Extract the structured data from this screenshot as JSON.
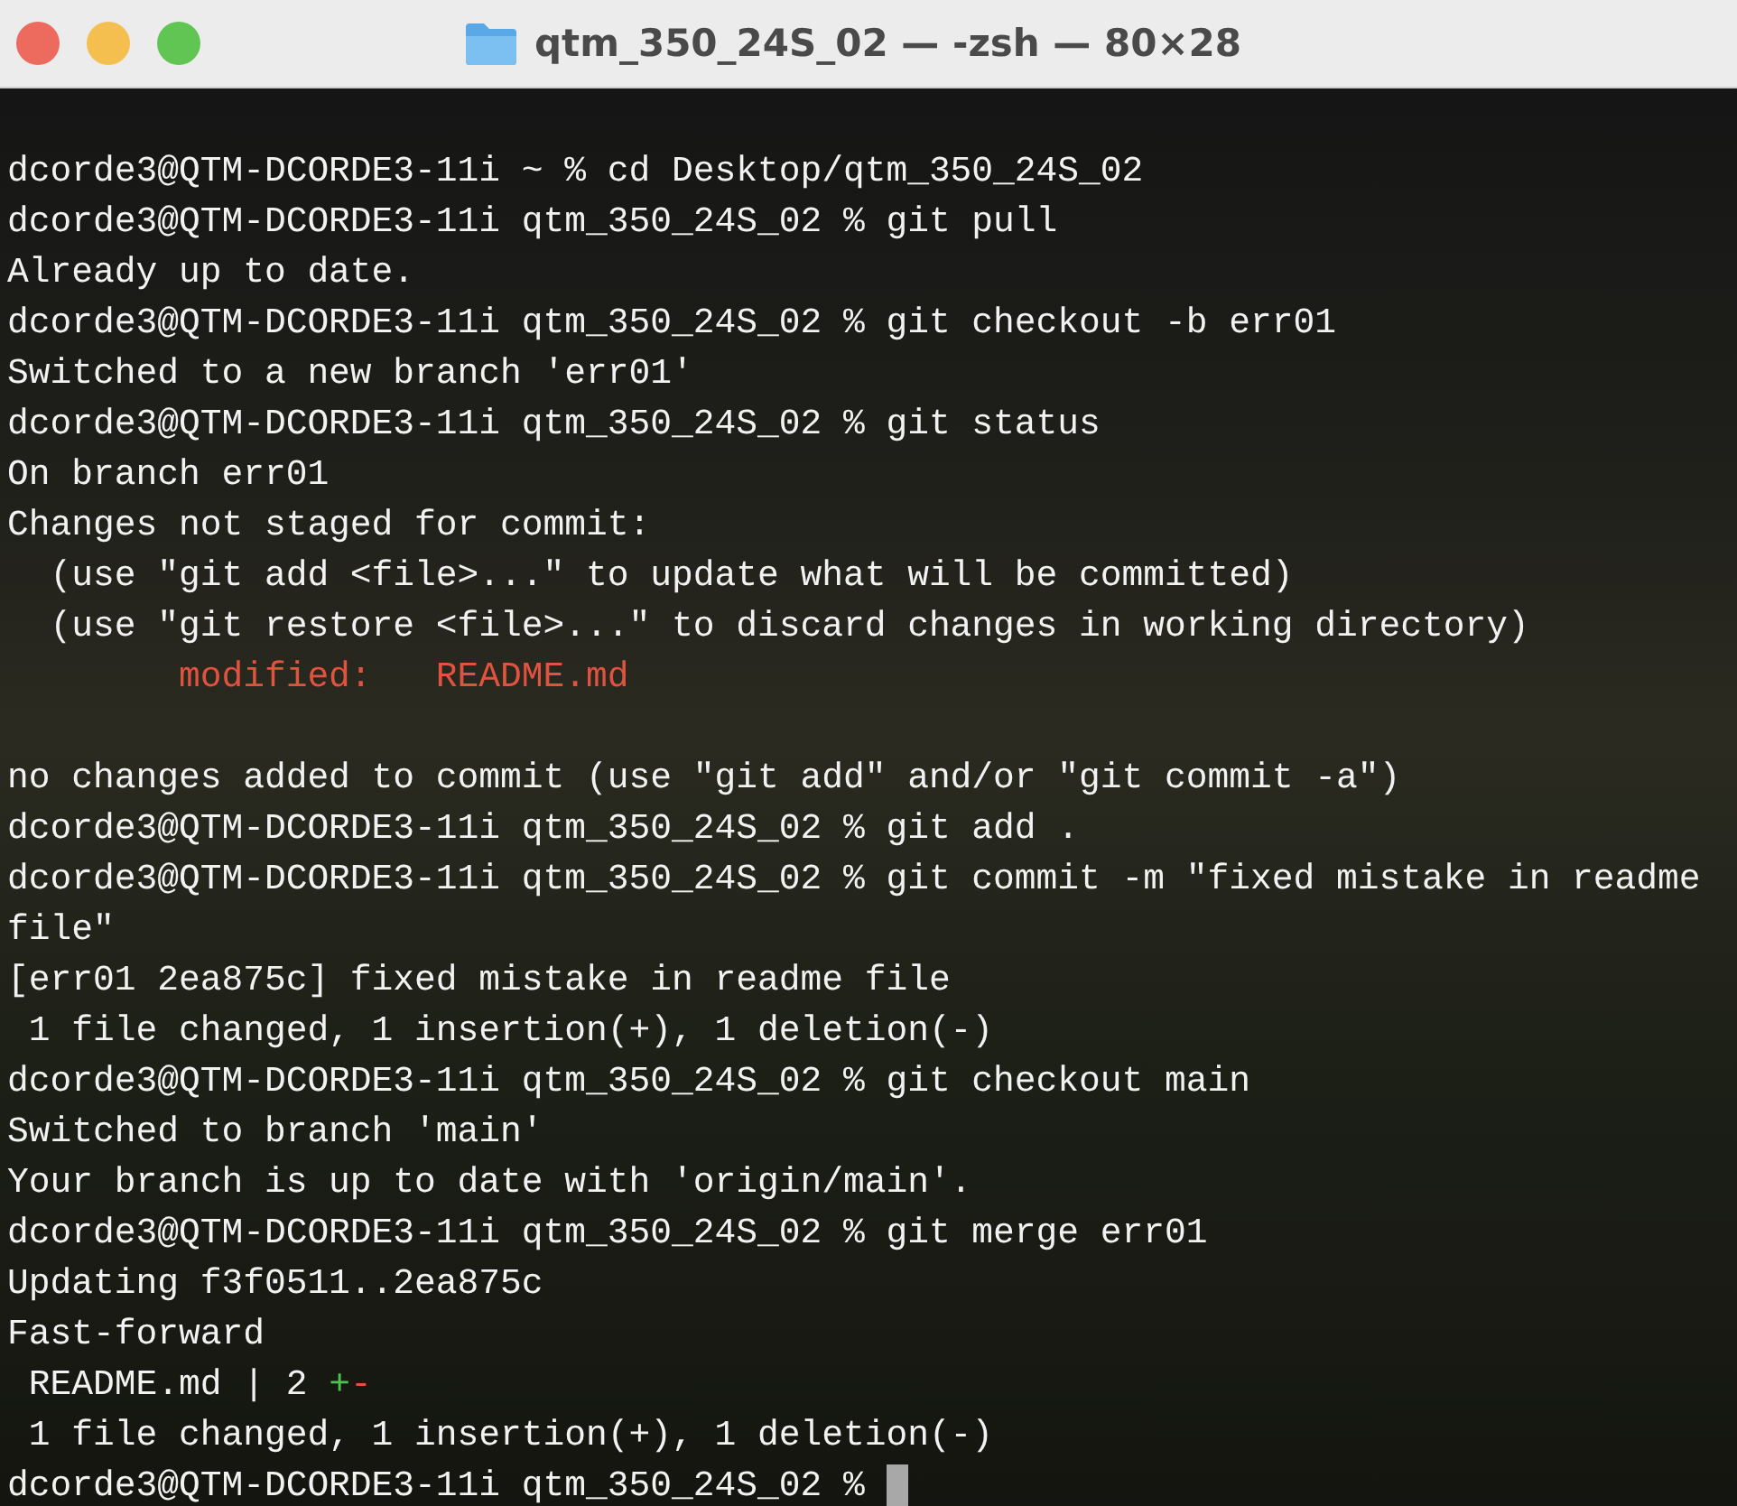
{
  "window": {
    "title": "qtm_350_24S_02 — -zsh — 80×28"
  },
  "terminal": {
    "blocks": [
      {
        "lines": [
          {
            "segments": [
              {
                "text": "dcorde3@QTM-DCORDE3-11i ~ % cd Desktop/qtm_350_24S_02",
                "kind": "plain"
              }
            ]
          },
          {
            "segments": [
              {
                "text": "dcorde3@QTM-DCORDE3-11i qtm_350_24S_02 % git pull",
                "kind": "plain"
              }
            ]
          },
          {
            "segments": [
              {
                "text": "Already up to date.",
                "kind": "plain"
              }
            ]
          },
          {
            "segments": [
              {
                "text": "dcorde3@QTM-DCORDE3-11i qtm_350_24S_02 % git checkout -b err01",
                "kind": "plain"
              }
            ]
          },
          {
            "segments": [
              {
                "text": "Switched to a new branch 'err01'",
                "kind": "plain"
              }
            ]
          },
          {
            "segments": [
              {
                "text": "dcorde3@QTM-DCORDE3-11i qtm_350_24S_02 % git status",
                "kind": "plain"
              }
            ]
          },
          {
            "segments": [
              {
                "text": "On branch err01",
                "kind": "plain"
              }
            ]
          },
          {
            "segments": [
              {
                "text": "Changes not staged for commit:",
                "kind": "plain"
              }
            ]
          },
          {
            "segments": [
              {
                "text": "  (use \"git add <file>...\" to update what will be committed)",
                "kind": "plain"
              }
            ]
          },
          {
            "segments": [
              {
                "text": "  (use \"git restore <file>...\" to discard changes in working directory)",
                "kind": "plain"
              }
            ]
          },
          {
            "segments": [
              {
                "text": "        modified:   README.md",
                "kind": "removed"
              }
            ]
          }
        ]
      },
      {
        "lines": [
          {
            "segments": [
              {
                "text": "no changes added to commit (use \"git add\" and/or \"git commit -a\")",
                "kind": "plain"
              }
            ]
          },
          {
            "segments": [
              {
                "text": "dcorde3@QTM-DCORDE3-11i qtm_350_24S_02 % git add .",
                "kind": "plain"
              }
            ]
          },
          {
            "segments": [
              {
                "text": "dcorde3@QTM-DCORDE3-11i qtm_350_24S_02 % git commit -m \"fixed mistake in readme",
                "kind": "plain"
              }
            ]
          },
          {
            "segments": [
              {
                "text": "file\"",
                "kind": "plain"
              }
            ]
          },
          {
            "segments": [
              {
                "text": "[err01 2ea875c] fixed mistake in readme file",
                "kind": "plain"
              }
            ]
          },
          {
            "segments": [
              {
                "text": " 1 file changed, 1 insertion(+), 1 deletion(-)",
                "kind": "plain"
              }
            ]
          },
          {
            "segments": [
              {
                "text": "dcorde3@QTM-DCORDE3-11i qtm_350_24S_02 % git checkout main",
                "kind": "plain"
              }
            ]
          },
          {
            "segments": [
              {
                "text": "Switched to branch 'main'",
                "kind": "plain"
              }
            ]
          },
          {
            "segments": [
              {
                "text": "Your branch is up to date with 'origin/main'.",
                "kind": "plain"
              }
            ]
          },
          {
            "segments": [
              {
                "text": "dcorde3@QTM-DCORDE3-11i qtm_350_24S_02 % git merge err01",
                "kind": "plain"
              }
            ]
          },
          {
            "segments": [
              {
                "text": "Updating f3f0511..2ea875c",
                "kind": "plain"
              }
            ]
          },
          {
            "segments": [
              {
                "text": "Fast-forward",
                "kind": "plain"
              }
            ]
          },
          {
            "segments": [
              {
                "text": " README.md | 2 ",
                "kind": "plain"
              },
              {
                "text": "+",
                "kind": "added"
              },
              {
                "text": "-",
                "kind": "removed"
              }
            ]
          },
          {
            "segments": [
              {
                "text": " 1 file changed, 1 insertion(+), 1 deletion(-)",
                "kind": "plain"
              }
            ]
          },
          {
            "segments": [
              {
                "text": "dcorde3@QTM-DCORDE3-11i qtm_350_24S_02 % ",
                "kind": "plain"
              }
            ],
            "cursor": true
          }
        ]
      }
    ]
  }
}
